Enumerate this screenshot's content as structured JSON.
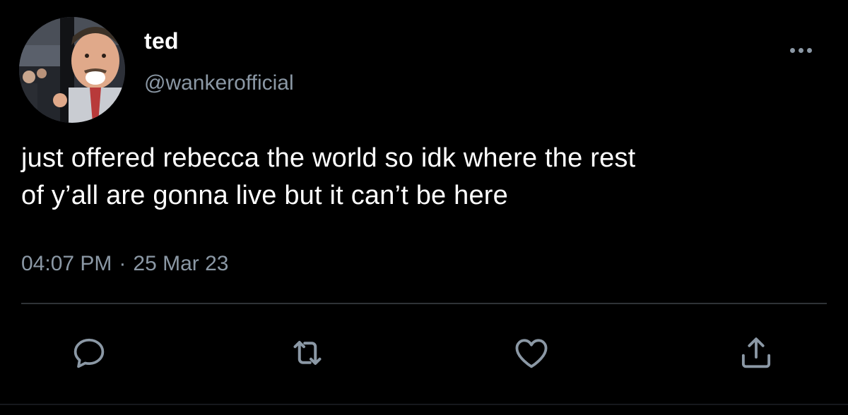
{
  "tweet": {
    "author": {
      "display_name": "ted",
      "handle": "@wankerofficial",
      "avatar_icon": "profile-photo"
    },
    "more_icon": "more-horizontal-icon",
    "text_lines": [
      "just offered rebecca the world so idk where the rest",
      "of y’all are gonna live but it can’t be here"
    ],
    "time": "04:07 PM",
    "separator": "·",
    "date": "25 Mar 23",
    "actions": {
      "reply_icon": "reply-icon",
      "retweet_icon": "retweet-icon",
      "like_icon": "heart-icon",
      "share_icon": "share-icon"
    }
  },
  "colors": {
    "background": "#000000",
    "primary_text": "#ffffff",
    "secondary_text": "#8b98a5",
    "divider": "#2f3336"
  }
}
